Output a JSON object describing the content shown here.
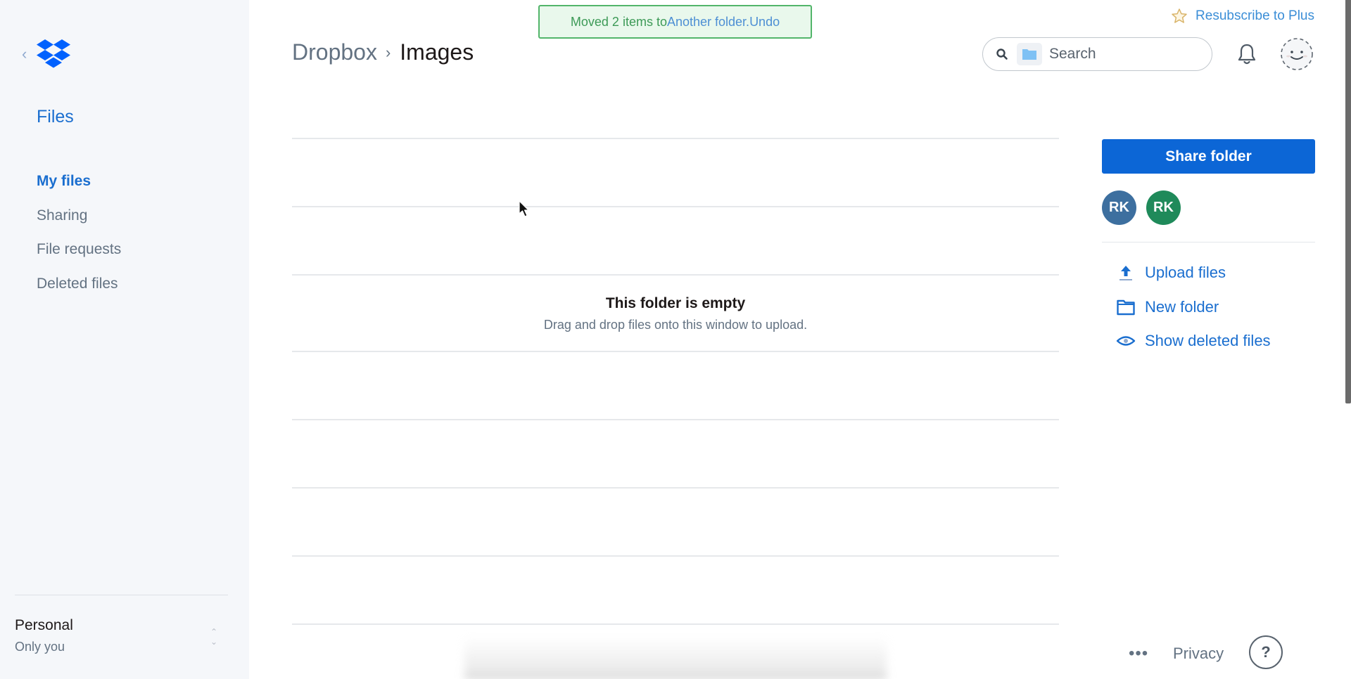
{
  "sidebar": {
    "back_icon": "chevron-left-icon",
    "logo_icon": "dropbox-logo-icon",
    "title": "Files",
    "items": [
      {
        "label": "My files",
        "active": true
      },
      {
        "label": "Sharing",
        "active": false
      },
      {
        "label": "File requests",
        "active": false
      },
      {
        "label": "Deleted files",
        "active": false
      }
    ],
    "account": {
      "name": "Personal",
      "sub": "Only you",
      "toggle_icon": "chevron-up-down-icon"
    }
  },
  "header": {
    "breadcrumb": {
      "root": "Dropbox",
      "separator": "›",
      "current": "Images"
    },
    "toast": {
      "message": "Moved 2 items to ",
      "link": "Another folder.",
      "undo": " Undo"
    },
    "resubscribe": {
      "icon": "star-icon",
      "label": "Resubscribe to Plus"
    },
    "search": {
      "placeholder": "Search",
      "value": ""
    }
  },
  "main": {
    "empty_title": "This folder is empty",
    "empty_sub": "Drag and drop files onto this window to upload."
  },
  "panel": {
    "share_button": "Share folder",
    "members": [
      {
        "initials": "RK",
        "color": "#3d6f9f"
      },
      {
        "initials": "RK",
        "color": "#1f8a5a"
      }
    ],
    "actions": [
      {
        "label": "Upload files",
        "icon": "upload-icon"
      },
      {
        "label": "New folder",
        "icon": "folder-icon"
      },
      {
        "label": "Show deleted files",
        "icon": "eye-icon"
      }
    ]
  },
  "footer": {
    "more": "•••",
    "privacy": "Privacy",
    "help": "?"
  },
  "colors": {
    "accent": "#0c66d6",
    "link": "#1a6ecf",
    "toast_bg": "#e9f8ec",
    "toast_border": "#52b56a"
  }
}
